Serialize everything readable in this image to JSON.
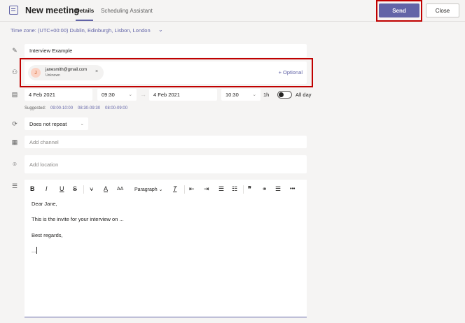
{
  "header": {
    "title": "New meeting",
    "tabs": [
      {
        "label": "Details",
        "active": true
      },
      {
        "label": "Scheduling Assistant",
        "active": false
      }
    ],
    "send_label": "Send",
    "close_label": "Close"
  },
  "timezone": "Time zone: (UTC+00:00) Dublin, Edinburgh, Lisbon, London",
  "form": {
    "title_value": "Interview Example",
    "attendee": {
      "initial": "J",
      "email": "janesmith@gmail.com",
      "status": "Unknown",
      "remove": "×"
    },
    "optional_label": "+ Optional",
    "start_date": "4 Feb 2021",
    "start_time": "09:30",
    "end_date": "4 Feb 2021",
    "end_time": "10:30",
    "duration": "1h",
    "allday_label": "All day",
    "allday_on": false,
    "suggested_label": "Suggested:",
    "suggested_slots": [
      "09:00-10:00",
      "08:30-09:30",
      "08:00-09:00"
    ],
    "repeat_value": "Does not repeat",
    "channel_placeholder": "Add channel",
    "location_placeholder": "Add location"
  },
  "editor": {
    "toolbar": {
      "bold": "B",
      "italic": "I",
      "underline": "U",
      "strike": "S",
      "paragraph": "Paragraph",
      "more": "•••"
    },
    "lines": [
      "Dear Jane,",
      "This is the invite for your interview on ...",
      "Best regards,",
      "..."
    ]
  },
  "colors": {
    "accent": "#6264a7",
    "highlight": "#c00000"
  },
  "icons": [
    "calendar-icon",
    "pencil-icon",
    "people-icon",
    "date-icon",
    "repeat-icon",
    "channel-icon",
    "location-icon",
    "details-icon"
  ]
}
